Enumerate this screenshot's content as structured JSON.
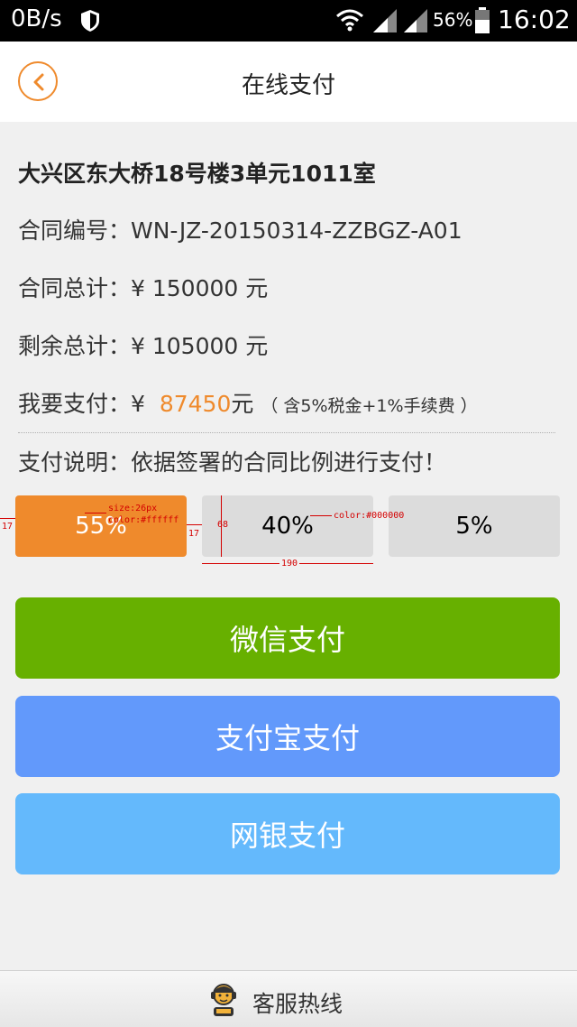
{
  "status_bar": {
    "net_speed": "0B/s",
    "battery_percent": "56%",
    "time": "16:02",
    "icons": [
      "shield-icon",
      "wifi-icon",
      "signal-icon",
      "signal-icon",
      "battery-icon"
    ]
  },
  "header": {
    "title": "在线支付",
    "back_icon": "chevron-left-icon"
  },
  "details": {
    "address": "大兴区东大桥18号楼3单元1011室",
    "contract_no_label": "合同编号：",
    "contract_no": "WN-JZ-20150314-ZZBGZ-A01",
    "contract_total_label": "合同总计：",
    "contract_total": "¥ 150000 元",
    "remaining_label": "剩余总计：",
    "remaining": "¥ 105000 元",
    "pay_label": "我要支付：",
    "pay_currency": "¥",
    "pay_amount": "87450",
    "pay_unit": "元",
    "pay_note": "（ 含5%税金+1%手续费 ）",
    "desc_label": "支付说明：",
    "desc": "依据签署的合同比例进行支付！"
  },
  "ratios": [
    {
      "label": "55%",
      "selected": true
    },
    {
      "label": "40%",
      "selected": false
    },
    {
      "label": "5%",
      "selected": false
    }
  ],
  "annotations": {
    "size_note": "size:26px",
    "color_white": "color:#ffffff",
    "color_black": "color:#000000",
    "height": "68",
    "width": "190",
    "gap": "17",
    "margin": "17"
  },
  "payment_buttons": {
    "wechat": "微信支付",
    "alipay": "支付宝支付",
    "bank": "网银支付"
  },
  "footer": {
    "hotline_label": "客服热线",
    "hotline_icon": "customer-service-icon"
  },
  "colors": {
    "accent": "#ef8a2c",
    "wechat": "#67b000",
    "alipay": "#6299fb",
    "bank": "#64b9fc"
  }
}
